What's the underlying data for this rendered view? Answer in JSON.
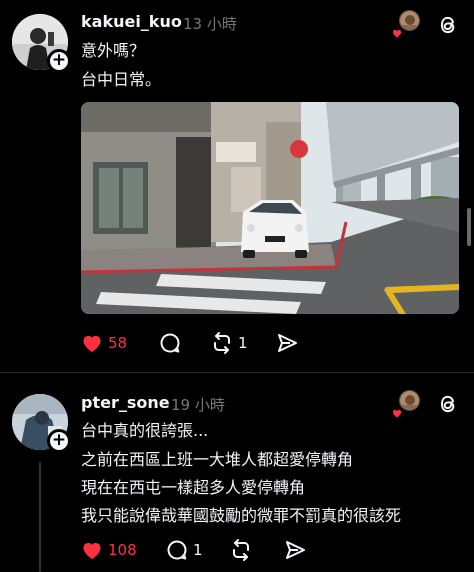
{
  "colors": {
    "background": "#000000",
    "text": "#f3f5f7",
    "muted": "#777777",
    "like_red": "#ff3040"
  },
  "posts": [
    {
      "username": "kakuei_kuo",
      "time": "13 小時",
      "lines": [
        "意外嗎？",
        "台中日常。"
      ],
      "has_photo": true,
      "actions": {
        "likes": "58",
        "comments": "",
        "reposts": "1"
      },
      "liked": true,
      "icons": [
        "heart-icon",
        "comment-icon",
        "repost-icon",
        "share-icon",
        "threads-logo-icon"
      ]
    },
    {
      "username": "pter_sone",
      "time": "19 小時",
      "lines": [
        "台中真的很誇張...",
        "之前在西區上班一大堆人都超愛停轉角",
        "現在在西屯一樣超多人愛停轉角",
        "我只能說偉哉華國鼓勵的微罪不罰真的很該死"
      ],
      "has_photo": false,
      "actions": {
        "likes": "108",
        "comments": "1",
        "reposts": ""
      },
      "liked": true,
      "icons": [
        "heart-icon",
        "comment-icon",
        "repost-icon",
        "share-icon",
        "threads-logo-icon"
      ]
    }
  ]
}
